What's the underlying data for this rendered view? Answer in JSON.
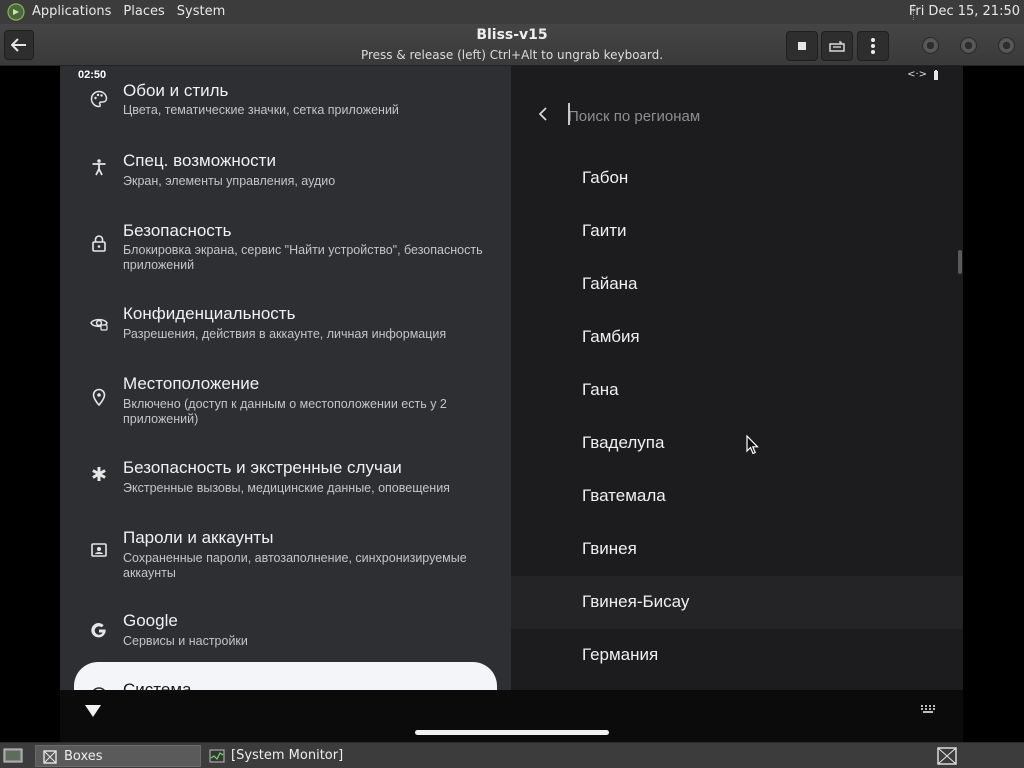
{
  "top_panel": {
    "menus": [
      "Applications",
      "Places",
      "System"
    ],
    "clock": "Fri Dec 15, 21:50"
  },
  "header": {
    "title": "Bliss-v15",
    "subtitle": "Press & release (left) Ctrl+Alt to ungrab keyboard."
  },
  "android": {
    "status_time": "02:50",
    "settings": [
      {
        "icon": "palette-icon",
        "title": "Обои и стиль",
        "subtitle": "Цвета, тематические значки, сетка приложений"
      },
      {
        "icon": "accessibility-icon",
        "title": "Спец. возможности",
        "subtitle": "Экран, элементы управления, аудио"
      },
      {
        "icon": "lock-icon",
        "title": "Безопасность",
        "subtitle": "Блокировка экрана, сервис \"Найти устройство\", безопасность приложений"
      },
      {
        "icon": "privacy-eye-icon",
        "title": "Конфиденциальность",
        "subtitle": "Разрешения, действия в аккаунте, личная информация"
      },
      {
        "icon": "location-pin-icon",
        "title": "Местоположение",
        "subtitle": "Включено (доступ к данным о местоположении есть у 2 приложений)"
      },
      {
        "icon": "asterisk-icon",
        "title": "Безопасность и экстренные случаи",
        "subtitle": "Экстренные вызовы, медицинские данные, оповещения"
      },
      {
        "icon": "account-box-icon",
        "title": "Пароли и аккаунты",
        "subtitle": "Сохраненные пароли, автозаполнение, синхронизируемые аккаунты"
      },
      {
        "icon": "google-g-icon",
        "title": "Google",
        "subtitle": "Сервисы и настройки"
      }
    ],
    "selected_item": {
      "icon": "info-icon",
      "title": "Система"
    },
    "search": {
      "placeholder": "Поиск по регионам"
    },
    "regions": [
      "Габон",
      "Гаити",
      "Гайана",
      "Гамбия",
      "Гана",
      "Гваделупа",
      "Гватемала",
      "Гвинея",
      "Гвинея-Бисау",
      "Германия"
    ],
    "highlighted_region": "Гвинея-Бисау"
  },
  "taskbar": {
    "tasks": [
      {
        "label": "Boxes",
        "active": true
      },
      {
        "label": "[System Monitor]",
        "active": false
      }
    ]
  },
  "colors": {
    "panel_bg": "#3c3c3c",
    "settings_bg": "#2e2f33",
    "regions_bg": "#1c1c1e",
    "selected_card_bg": "#f4f5f8"
  }
}
